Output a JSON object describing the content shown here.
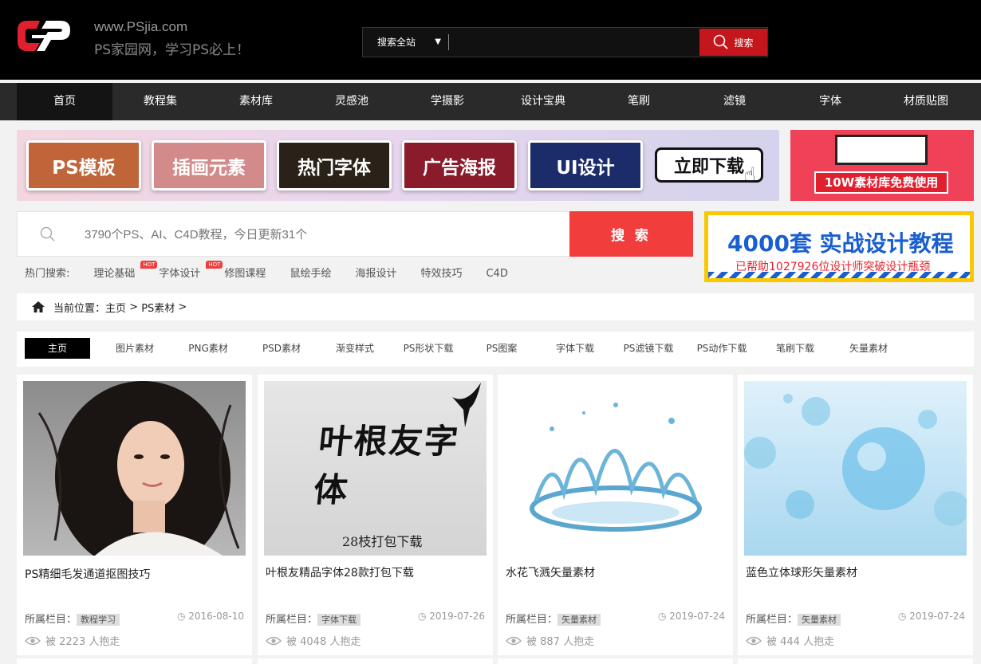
{
  "header": {
    "site_url": "www.PSjia.com",
    "slogan": "PS家园网，学习PS必上！",
    "search_scope": "搜索全站",
    "search_button": "搜索",
    "search_placeholder": ""
  },
  "nav": {
    "items": [
      {
        "label": "首页"
      },
      {
        "label": "教程集"
      },
      {
        "label": "素材库"
      },
      {
        "label": "灵感池"
      },
      {
        "label": "学摄影"
      },
      {
        "label": "设计宝典"
      },
      {
        "label": "笔刷"
      },
      {
        "label": "滤镜"
      },
      {
        "label": "字体"
      },
      {
        "label": "材质贴图"
      }
    ]
  },
  "promo": {
    "tiles": [
      {
        "label": "PS模板",
        "color": "#c0643a"
      },
      {
        "label": "插画元素",
        "color": "#d38a8a"
      },
      {
        "label": "热门字体",
        "color": "#2a2218"
      },
      {
        "label": "广告海报",
        "color": "#8a1b2a"
      },
      {
        "label": "UI设计",
        "color": "#1c2c6a"
      }
    ],
    "download_label": "立即下载",
    "ad_right_text": "10W素材库免费使用"
  },
  "big_search": {
    "placeholder": "3790个PS、AI、C4D教程，今日更新31个",
    "button": "搜 索"
  },
  "hot": {
    "label": "热门搜索:",
    "tags": [
      {
        "label": "理论基础",
        "badge": "HOT"
      },
      {
        "label": "字体设计",
        "badge": "HOT"
      },
      {
        "label": "修图课程",
        "badge": ""
      },
      {
        "label": "鼠绘手绘",
        "badge": ""
      },
      {
        "label": "海报设计",
        "badge": ""
      },
      {
        "label": "特效技巧",
        "badge": ""
      },
      {
        "label": "C4D",
        "badge": ""
      }
    ]
  },
  "ad_course": {
    "title": "4000套 实战设计教程",
    "subtitle": "已帮助1027926位设计师突破设计瓶颈"
  },
  "breadcrumb": {
    "label": "当前位置：",
    "home": "主页",
    "sep1": " > ",
    "current": "PS素材",
    "sep2": " >"
  },
  "categories": {
    "items": [
      {
        "label": "主页"
      },
      {
        "label": "图片素材"
      },
      {
        "label": "PNG素材"
      },
      {
        "label": "PSD素材"
      },
      {
        "label": "渐变样式"
      },
      {
        "label": "PS形状下载"
      },
      {
        "label": "PS图案"
      },
      {
        "label": "字体下载"
      },
      {
        "label": "PS滤镜下载"
      },
      {
        "label": "PS动作下载"
      },
      {
        "label": "笔刷下载"
      },
      {
        "label": "矢量素材"
      }
    ]
  },
  "cards": [
    {
      "title": "PS精细毛发通道抠图技巧",
      "column_label": "所属栏目：",
      "column": "教程学习",
      "date": "2016-08-10",
      "views": "被 2223 人抱走"
    },
    {
      "title": "叶根友精品字体28款打包下载",
      "column_label": "所属栏目：",
      "column": "字体下载",
      "date": "2019-07-26",
      "views": "被 4048 人抱走"
    },
    {
      "title": "水花飞溅矢量素材",
      "column_label": "所属栏目：",
      "column": "矢量素材",
      "date": "2019-07-24",
      "views": "被 887 人抱走"
    },
    {
      "title": "蓝色立体球形矢量素材",
      "column_label": "所属栏目：",
      "column": "矢量素材",
      "date": "2019-07-24",
      "views": "被 444 人抱走"
    }
  ],
  "thumb_text": {
    "calligraphy": "叶根友字体",
    "calligraphy_sub": "28枝打包下载"
  }
}
